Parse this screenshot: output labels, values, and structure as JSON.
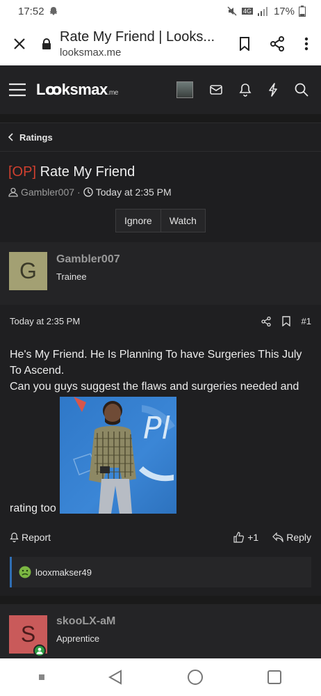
{
  "status_bar": {
    "time": "17:52",
    "network": "4G",
    "battery": "17%"
  },
  "browser": {
    "title": "Rate My Friend | Looks...",
    "domain": "looksmax.me"
  },
  "site": {
    "logo": "Lꝏksmax",
    "logo_suffix": ".me"
  },
  "breadcrumb": {
    "label": "Ratings"
  },
  "thread": {
    "prefix": "[OP]",
    "title": "Rate My Friend",
    "author": "Gambler007",
    "separator": "·",
    "date": "Today at 2:35 PM",
    "buttons": {
      "ignore": "Ignore",
      "watch": "Watch"
    }
  },
  "post": {
    "author_initial": "G",
    "author": "Gambler007",
    "author_title": "Trainee",
    "date": "Today at 2:35 PM",
    "number": "#1",
    "text_line1": "He's My Friend. He Is Planning To have Surgeries This July To Ascend.",
    "text_line2": "Can you guys suggest the flaws and surgeries needed and",
    "text_tail": "rating too",
    "report": "Report",
    "like_count": "+1",
    "reply": "Reply",
    "reaction_user": "looxmakser49"
  },
  "next_post": {
    "author_initial": "S",
    "author": "skooLX-aM",
    "author_title": "Apprentice"
  },
  "colors": {
    "accent": "#2f6fb5",
    "prefix": "#d0402f",
    "online": "#2e9e44"
  }
}
